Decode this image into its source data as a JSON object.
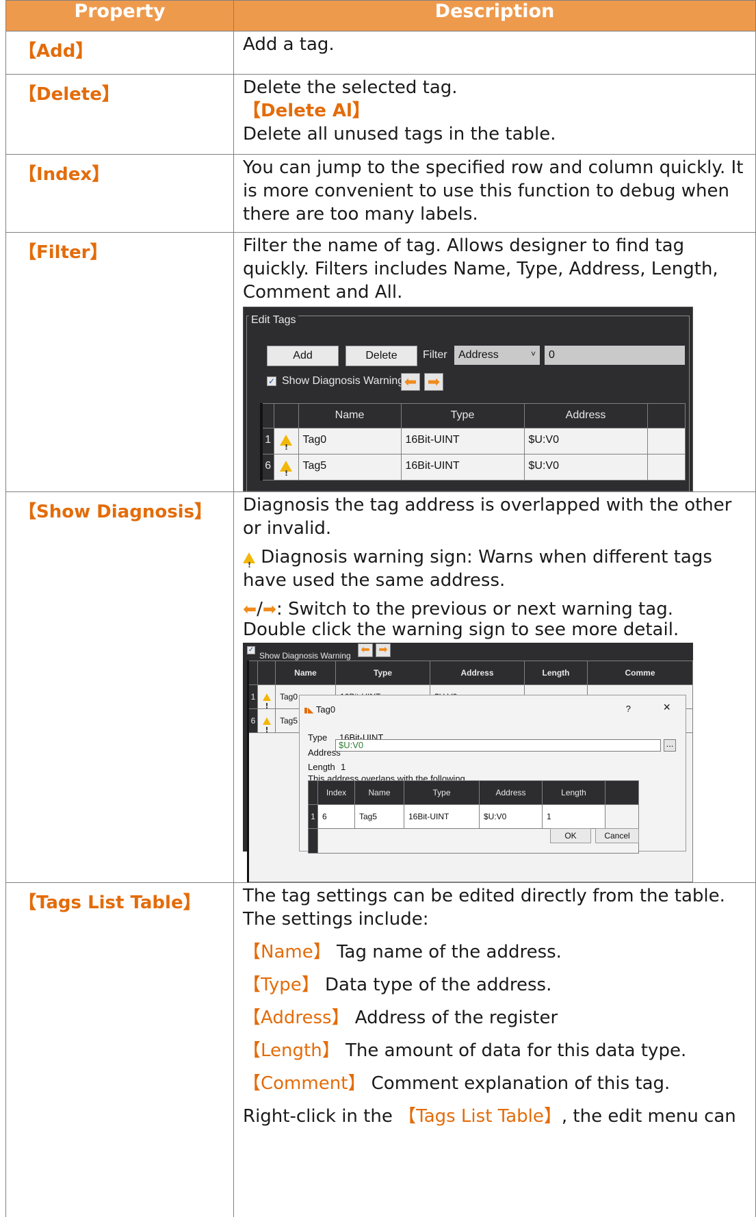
{
  "header": {
    "property": "Property",
    "description": "Description"
  },
  "rows": {
    "add": {
      "property": "【Add】",
      "desc": "Add a tag."
    },
    "delete": {
      "property": "【Delete】",
      "desc1": "Delete the selected tag.",
      "sub": "【Delete Al】",
      "desc2": "Delete all unused tags in the table."
    },
    "index": {
      "property": "【Index】",
      "desc": "You can jump to the specified row and column quickly. It is more convenient to use this function to debug when there are too many labels."
    },
    "filter": {
      "property": "【Filter】",
      "desc": "Filter the name of tag. Allows designer to find tag quickly. Filters includes Name, Type, Address, Length, Comment and All."
    },
    "diagnosis": {
      "property": "【Show Diagnosis】",
      "desc1": "Diagnosis the tag address is overlapped with the other or invalid.",
      "desc2": " Diagnosis warning sign: Warns when different tags have used the same address.",
      "desc3": ": Switch to the previous or next warning tag.",
      "desc4": "Double click the warning sign to see more detail."
    },
    "tags": {
      "property": "【Tags List Table】",
      "desc1": "The tag settings can be edited directly from the table. The settings include:",
      "name_k": "【Name】",
      "name_v": " Tag name of the address.",
      "type_k": "【Type】",
      "type_v": " Data type of the address.",
      "addr_k": "【Address】",
      "addr_v": " Address of the register",
      "len_k": "【Length】",
      "len_v": " The amount of data for this data type.",
      "com_k": "【Comment】",
      "com_v": " Comment explanation of this tag.",
      "right_pre": "Right-click in the ",
      "right_k": "【Tags List Table】",
      "right_post": ", the edit menu can"
    }
  },
  "shot1": {
    "legend": "Edit Tags",
    "add": "Add",
    "delete": "Delete",
    "filter_label": "Filter",
    "filter_value": "Address",
    "filter_text": "0",
    "show_diag": "Show Diagnosis Warning",
    "cols": [
      "Name",
      "Type",
      "Address"
    ],
    "rows": [
      {
        "num": "1",
        "name": "Tag0",
        "type": "16Bit-UINT",
        "address": "$U:V0"
      },
      {
        "num": "6",
        "name": "Tag5",
        "type": "16Bit-UINT",
        "address": "$U:V0"
      }
    ]
  },
  "shot2": {
    "show_diag": "Show Diagnosis Warning",
    "cols": [
      "Name",
      "Type",
      "Address",
      "Length",
      "Comme"
    ],
    "row1": {
      "num": "1",
      "name": "Tag0",
      "type": "16Bit-UINT",
      "address": "$U:V0"
    },
    "row6": {
      "num": "6",
      "name": "Tag5"
    },
    "dialog": {
      "title": "Tag0",
      "help": "?",
      "close": "×",
      "type_label": "Type",
      "type_value": "16Bit-UINT",
      "addr_label": "Address",
      "addr_value": "$U:V0",
      "browse": "...",
      "len_label": "Length",
      "len_value": "1",
      "overlap": "This address overlaps with the following",
      "cols": [
        "Index",
        "Name",
        "Type",
        "Address",
        "Length"
      ],
      "row": {
        "num": "1",
        "index": "6",
        "name": "Tag5",
        "type": "16Bit-UINT",
        "address": "$U:V0",
        "length": "1"
      },
      "ok": "OK",
      "cancel": "Cancel"
    }
  },
  "colors": {
    "header_bg": "#ee9a4d",
    "accent": "#e36c0a",
    "warning": "#f2b70a",
    "arrow": "#f08a1c"
  }
}
